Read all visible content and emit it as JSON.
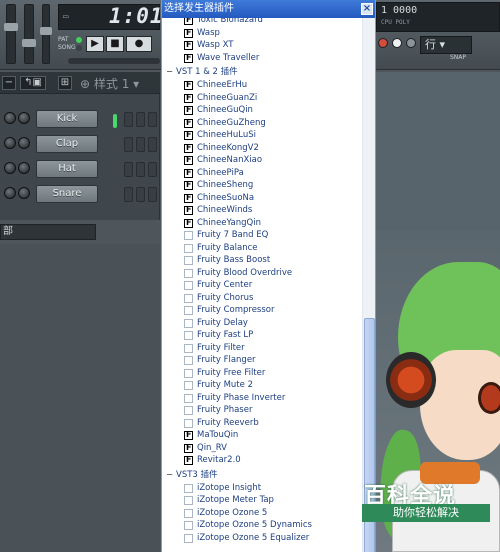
{
  "daw": {
    "time_display": "1:01.",
    "transport_labels": [
      "PAT",
      "SONG"
    ],
    "pattern_selector": "样式 1",
    "browser_label": "部",
    "channels": [
      {
        "label": "Kick"
      },
      {
        "label": "Clap"
      },
      {
        "label": "Hat"
      },
      {
        "label": "Snare"
      }
    ],
    "right_lcd_top": "1  0000",
    "right_lcd_bottom": "CPU  POLY",
    "mode_select": "行",
    "snap_label": "SNAP"
  },
  "dialog": {
    "title": "选择发生器插件",
    "close_label": "×",
    "groups": [
      {
        "header": "",
        "items": [
          {
            "label": "Toxic Biohazard",
            "checked": true
          },
          {
            "label": "Wasp",
            "checked": true
          },
          {
            "label": "Wasp XT",
            "checked": true
          },
          {
            "label": "Wave Traveller",
            "checked": true
          }
        ]
      },
      {
        "header": "VST 1 & 2 插件",
        "items": [
          {
            "label": "ChineeErHu",
            "checked": true
          },
          {
            "label": "ChineeGuanZi",
            "checked": true
          },
          {
            "label": "ChineeGuQin",
            "checked": true
          },
          {
            "label": "ChineeGuZheng",
            "checked": true
          },
          {
            "label": "ChineeHuLuSi",
            "checked": true
          },
          {
            "label": "ChineeKongV2",
            "checked": true
          },
          {
            "label": "ChineeNanXiao",
            "checked": true
          },
          {
            "label": "ChineePiPa",
            "checked": true
          },
          {
            "label": "ChineeSheng",
            "checked": true
          },
          {
            "label": "ChineeSuoNa",
            "checked": true
          },
          {
            "label": "ChineeWinds",
            "checked": true
          },
          {
            "label": "ChineeYangQin",
            "checked": true
          },
          {
            "label": "Fruity 7 Band EQ",
            "checked": false
          },
          {
            "label": "Fruity Balance",
            "checked": false
          },
          {
            "label": "Fruity Bass Boost",
            "checked": false
          },
          {
            "label": "Fruity Blood Overdrive",
            "checked": false
          },
          {
            "label": "Fruity Center",
            "checked": false
          },
          {
            "label": "Fruity Chorus",
            "checked": false
          },
          {
            "label": "Fruity Compressor",
            "checked": false
          },
          {
            "label": "Fruity Delay",
            "checked": false
          },
          {
            "label": "Fruity Fast LP",
            "checked": false
          },
          {
            "label": "Fruity Filter",
            "checked": false
          },
          {
            "label": "Fruity Flanger",
            "checked": false
          },
          {
            "label": "Fruity Free Filter",
            "checked": false
          },
          {
            "label": "Fruity Mute 2",
            "checked": false
          },
          {
            "label": "Fruity Phase Inverter",
            "checked": false
          },
          {
            "label": "Fruity Phaser",
            "checked": false
          },
          {
            "label": "Fruity Reeverb",
            "checked": false
          },
          {
            "label": "MaTouQin",
            "checked": true
          },
          {
            "label": "Qin_RV",
            "checked": true
          },
          {
            "label": "Revitar2.0",
            "checked": true
          }
        ]
      },
      {
        "header": "VST3 插件",
        "items": [
          {
            "label": "iZotope Insight",
            "checked": false
          },
          {
            "label": "iZotope Meter Tap",
            "checked": false
          },
          {
            "label": "iZotope Ozone 5",
            "checked": false
          },
          {
            "label": "iZotope Ozone 5 Dynamics",
            "checked": false
          },
          {
            "label": "iZotope Ozone 5 Equalizer",
            "checked": false
          }
        ]
      }
    ]
  },
  "watermark": {
    "title": "百科全说",
    "subtitle": "助你轻松解决"
  }
}
